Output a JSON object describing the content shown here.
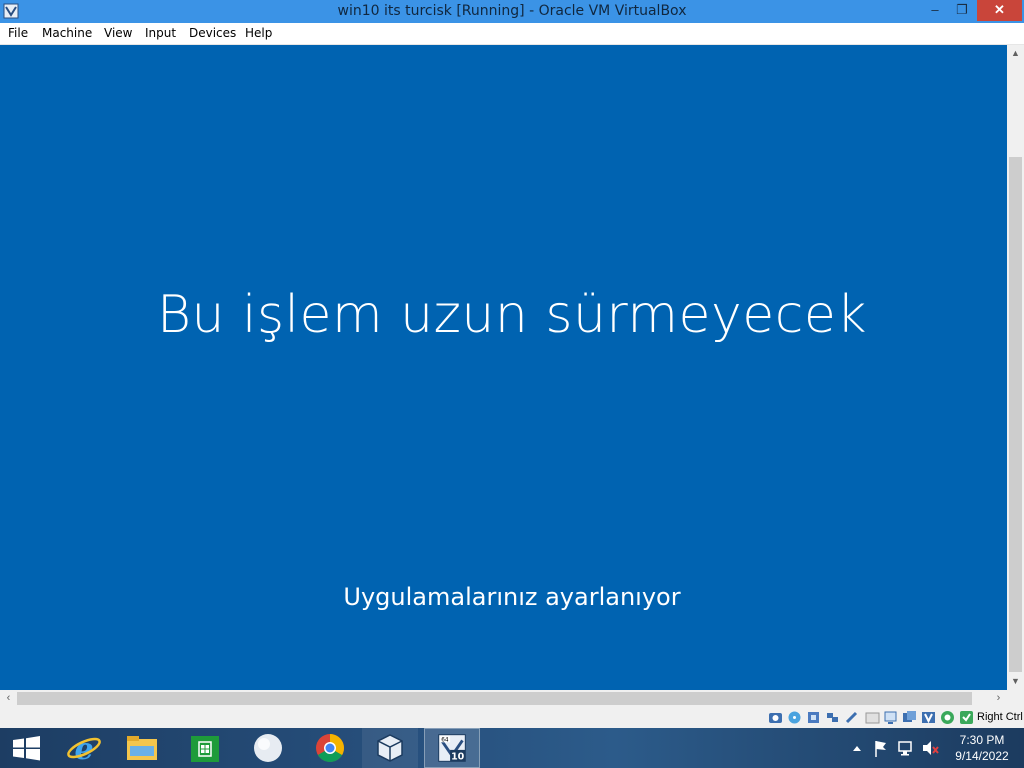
{
  "window": {
    "title": "win10 its turcisk [Running] - Oracle VM VirtualBox",
    "minimize_glyph": "–",
    "maximize_glyph": "❐",
    "close_glyph": "✕"
  },
  "menu": {
    "items": [
      {
        "label": "File"
      },
      {
        "label": "Machine"
      },
      {
        "label": "View"
      },
      {
        "label": "Input"
      },
      {
        "label": "Devices"
      },
      {
        "label": "Help"
      }
    ]
  },
  "guest": {
    "heading": "Bu işlem uzun sürmeyecek",
    "subheading": "Uygulamalarınız ayarlanıyor",
    "background_color": "#0063b1"
  },
  "statusbar": {
    "host_key": "Right Ctrl",
    "icons": [
      "hard-disk-icon",
      "optical-drive-icon",
      "audio-icon",
      "network-icon",
      "usb-icon",
      "shared-folders-icon",
      "display-icon",
      "video-capture-icon",
      "recording-icon",
      "cpu-icon",
      "mouse-integration-icon",
      "keyboard-icon"
    ]
  },
  "taskbar": {
    "buttons": [
      "start-button",
      "internet-explorer-icon",
      "file-explorer-icon",
      "store-icon",
      "unknown-app-icon",
      "chrome-icon",
      "virtualbox-icon",
      "win10-vm-icon"
    ],
    "clock_time": "7:30 PM",
    "clock_date": "9/14/2022",
    "tray_icons": [
      "show-hidden-icons",
      "action-center-flag-icon",
      "network-tray-icon",
      "volume-muted-icon"
    ]
  }
}
